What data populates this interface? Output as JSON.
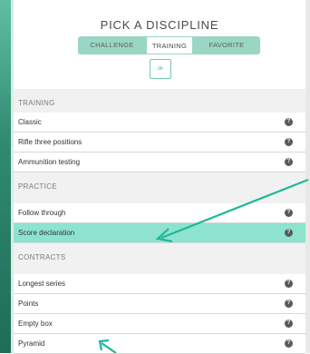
{
  "header": {
    "title": "PICK A DISCIPLINE",
    "ok_label": "ok"
  },
  "tabs": [
    {
      "label": "CHALLENGE",
      "active": false
    },
    {
      "label": "TRAINING",
      "active": true
    },
    {
      "label": "FAVORITE",
      "active": false
    }
  ],
  "sections": [
    {
      "title": "TRAINING",
      "items": [
        {
          "label": "Classic",
          "help": "?"
        },
        {
          "label": "Rifle three positions",
          "help": "?"
        },
        {
          "label": "Ammunition testing",
          "help": "?"
        }
      ]
    },
    {
      "title": "PRACTICE",
      "items": [
        {
          "label": "Follow through",
          "help": "?"
        },
        {
          "label": "Score declaration",
          "help": "?",
          "highlighted": true
        }
      ]
    },
    {
      "title": "CONTRACTS",
      "items": [
        {
          "label": "Longest series",
          "help": "?"
        },
        {
          "label": "Points",
          "help": "?"
        },
        {
          "label": "Empty box",
          "help": "?"
        },
        {
          "label": "Pyramid",
          "help": "?"
        }
      ]
    }
  ],
  "colors": {
    "accent": "#8ee3cf",
    "arrow": "#1fb79a",
    "frame": "#2f8b6f"
  }
}
